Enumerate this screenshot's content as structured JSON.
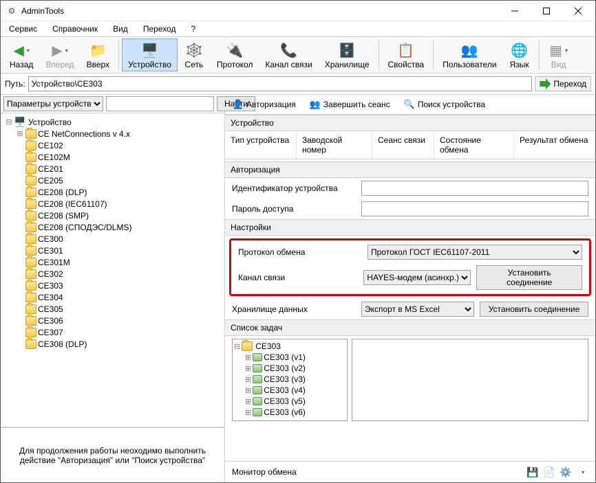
{
  "window": {
    "title": "AdminTools"
  },
  "menu": {
    "items": [
      "Сервис",
      "Справочник",
      "Вид",
      "Переход",
      "?"
    ]
  },
  "toolbar": {
    "back": "Назад",
    "forward": "Вперед",
    "up": "Вверх",
    "device": "Устройство",
    "network": "Сеть",
    "protocol": "Протокол",
    "channel": "Канал связи",
    "storage": "Хранилище",
    "properties": "Свойства",
    "users": "Пользователи",
    "language": "Язык",
    "view": "Вид"
  },
  "pathbar": {
    "label": "Путь:",
    "value": "Устройство\\CE303",
    "go": "Переход"
  },
  "left": {
    "filter_label": "Параметры устройств",
    "search": "",
    "find": "Найти",
    "root": "Устройство",
    "items": [
      "CE NetConnections v 4.x",
      "CE102",
      "CE102M",
      "CE201",
      "CE205",
      "CE208 (DLP)",
      "CE208 (IEC61107)",
      "CE208 (SMP)",
      "CE208 (СПОДЭС/DLMS)",
      "CE300",
      "CE301",
      "CE301M",
      "CE302",
      "CE303",
      "CE304",
      "CE305",
      "CE306",
      "CE307",
      "CE308 (DLP)"
    ],
    "hint": "Для продолжения работы неоходимо выполнить действие \"Авторизация\" или \"Поиск устройства\""
  },
  "right": {
    "actions": {
      "auth": "Авторизация",
      "end": "Завершить сеанс",
      "search": "Поиск устройства"
    },
    "group_device": "Устройство",
    "grid_headers": [
      "Тип устройства",
      "Заводской номер",
      "Сеанс связи",
      "Состояние обмена",
      "Результат обмена"
    ],
    "group_auth": "Авторизация",
    "id_label": "Идентификатор устройства",
    "id_value": "",
    "pwd_label": "Пароль доступа",
    "pwd_value": "",
    "group_settings": "Настройки",
    "proto_label": "Протокол обмена",
    "proto_value": "Протокол ГОСТ IEC61107-2011",
    "chan_label": "Канал связи",
    "chan_value": "HAYES-модем (асинхр.)",
    "store_label": "Хранилище данных",
    "store_value": "Экспорт в MS Excel",
    "conn_btn": "Установить соединение",
    "group_tasks": "Список задач",
    "task_root": "CE303",
    "task_items": [
      "CE303 (v1)",
      "CE303 (v2)",
      "CE303 (v3)",
      "CE303 (v4)",
      "CE303 (v5)",
      "CE303 (v6)"
    ],
    "monitor": "Монитор обмена"
  }
}
